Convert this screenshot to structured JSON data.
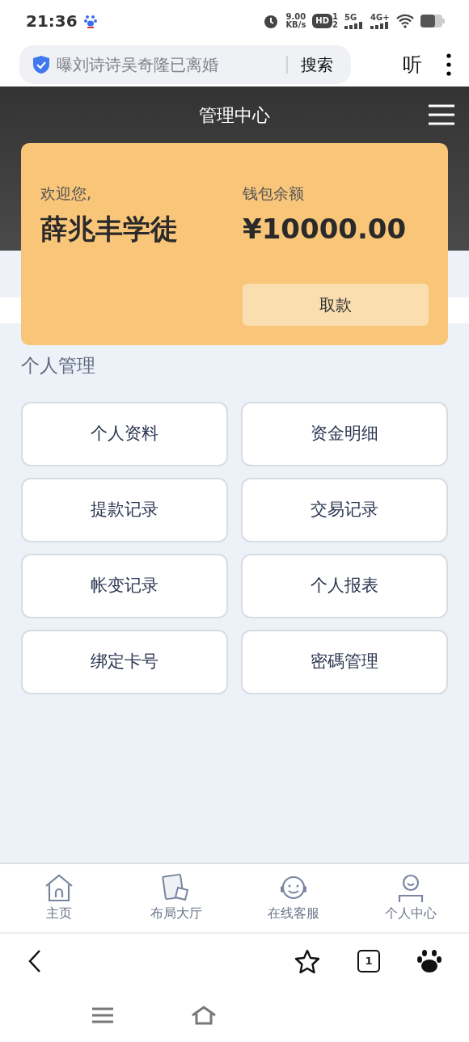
{
  "status_bar": {
    "time": "21:36",
    "net_speed": "9.00",
    "net_unit": "KB/s",
    "hd": "HD",
    "sim_1": "1",
    "sim_2": "2",
    "net_1": "5G",
    "net_2": "4G+"
  },
  "browser": {
    "search_text": "曝刘诗诗吴奇隆已离婚",
    "search_button": "搜索",
    "listen_button": "听",
    "tab_count": "1"
  },
  "header": {
    "title": "管理中心"
  },
  "wallet": {
    "greeting": "欢迎您,",
    "username": "薛兆丰学徒",
    "balance_label": "钱包余额",
    "balance": "¥10000.00",
    "withdraw_button": "取款"
  },
  "section_title": "个人管理",
  "menu_buttons": [
    "个人资料",
    "资金明细",
    "提款记录",
    "交易记录",
    "帐变记录",
    "个人报表",
    "绑定卡号",
    "密碼管理"
  ],
  "bottom_nav": [
    {
      "label": "主页",
      "kind": "home"
    },
    {
      "label": "布局大厅",
      "kind": "cards"
    },
    {
      "label": "在线客服",
      "kind": "support"
    },
    {
      "label": "个人中心",
      "kind": "person"
    }
  ]
}
